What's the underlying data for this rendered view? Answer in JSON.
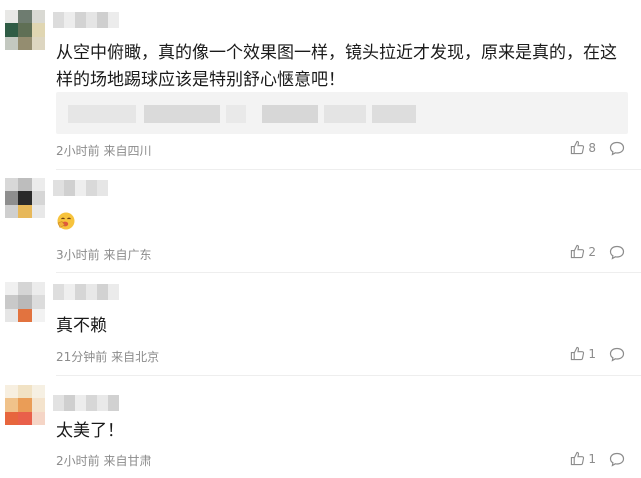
{
  "comments": [
    {
      "text": "从空中俯瞰，真的像一个效果图一样，镜头拉近才发现，原来是真的，在这样的场地踢球应该是特别舒心惬意吧！",
      "meta": "2小时前 来自四川",
      "likes": "8",
      "avatar_colors": [
        "#e8e8e6",
        "#6e7c70",
        "#d9d9d3",
        "#2f5c45",
        "#5f6f55",
        "#e0d6b2",
        "#c3c8c0",
        "#948d70",
        "#ddd6c1"
      ],
      "username_colors": [
        "#dcdcdc",
        "#ededed",
        "#d3d3d3",
        "#e5e5e5",
        "#cfcfcf",
        "#ececec"
      ]
    },
    {
      "text": "",
      "emoji": "face-with-hand-over-mouth-emoji",
      "meta": "3小时前 来自广东",
      "likes": "2",
      "avatar_colors": [
        "#d8d8d8",
        "#bdbdbd",
        "#ececec",
        "#8e8e8e",
        "#2a2a2a",
        "#d6d6d6",
        "#cfcfcf",
        "#e7b85a",
        "#e8e8e8"
      ],
      "username_colors": [
        "#e0e0e0",
        "#d0d0d0",
        "#eeeeee",
        "#d9d9d9",
        "#e6e6e6"
      ]
    },
    {
      "text": "真不赖",
      "meta": "21分钟前 来自北京",
      "likes": "1",
      "avatar_colors": [
        "#f0f0f0",
        "#d5d5d5",
        "#ececec",
        "#c9c9c9",
        "#b9b9b9",
        "#dcdcdc",
        "#e6e6e6",
        "#e2733f",
        "#f2f2f2"
      ],
      "username_colors": [
        "#dedede",
        "#efefef",
        "#d6d6d6",
        "#e8e8e8",
        "#d2d2d2",
        "#ebebeb"
      ]
    },
    {
      "text": "太美了！",
      "meta": "2小时前 来自甘肃",
      "likes": "1",
      "avatar_colors": [
        "#f7efe0",
        "#f1e2c4",
        "#f6f0e3",
        "#f0c28a",
        "#ea9d57",
        "#f4e3cc",
        "#e7663d",
        "#e9604a",
        "#f5d5c6"
      ],
      "username_colors": [
        "#e2e2e2",
        "#cfcfcf",
        "#ededed",
        "#d7d7d7",
        "#e9e9e9",
        "#d1d1d1"
      ]
    }
  ],
  "quote_blur_colors": [
    "#e9e9e9",
    "#dcdcdc",
    "#ebebeb",
    "#d6d6d6",
    "#e4e4e4",
    "#dadada",
    "#eeeeee",
    "#d9d9d9"
  ],
  "colors": {
    "meta_text": "#8c8c8c",
    "divider": "#eeeeee"
  }
}
